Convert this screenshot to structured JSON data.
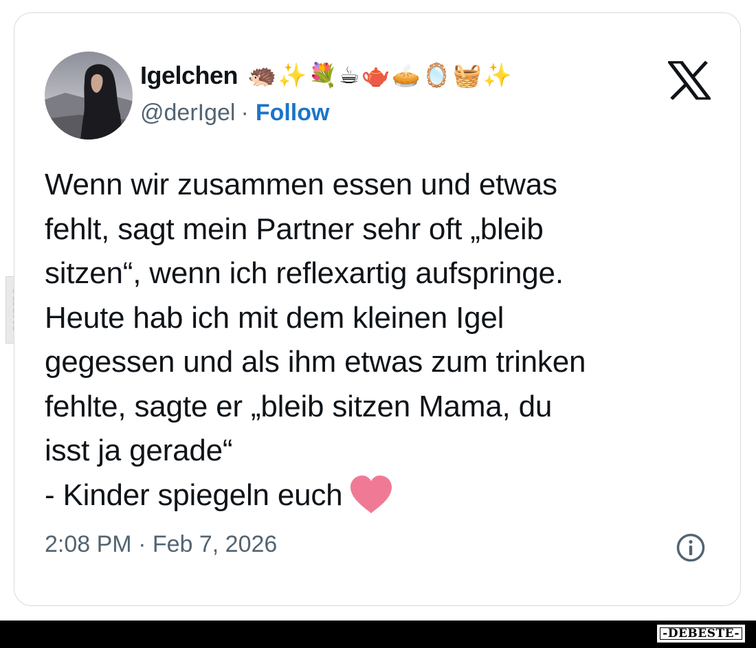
{
  "watermark": {
    "side_text": "DEBESTE",
    "bottom_text": "-DEBESTE-"
  },
  "tweet": {
    "author": {
      "display_name": "Igelchen",
      "emojis": "🦔✨💐☕🫖🥧🪞🧺✨",
      "handle": "@derIgel",
      "separator": "·",
      "follow_label": "Follow"
    },
    "platform_icon": "x-logo-icon",
    "text_lines": [
      "Wenn wir zusammen essen und etwas",
      "fehlt, sagt mein Partner sehr oft „bleib",
      "sitzen“, wenn ich reflexartig aufspringe.",
      "Heute hab ich mit dem kleinen Igel",
      "gegessen und als ihm etwas zum trinken",
      "fehlte, sagte er „bleib sitzen Mama, du",
      "isst ja gerade“",
      "- Kinder spiegeln euch"
    ],
    "trailing_emoji": "heart-icon",
    "timestamp": "2:08 PM · Feb 7, 2026"
  },
  "colors": {
    "text": "#0f1419",
    "secondary": "#536471",
    "follow": "#1d74c9",
    "heart": "#f07a96",
    "border": "#d9d9d9"
  }
}
